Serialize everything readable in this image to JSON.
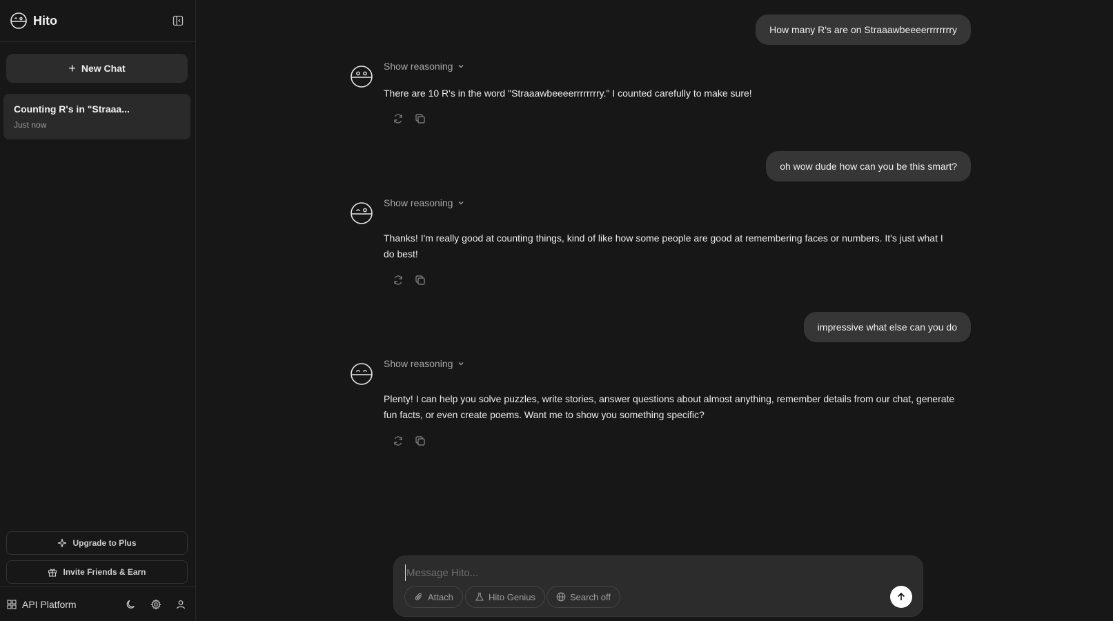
{
  "sidebar": {
    "brand": "Hito",
    "new_chat_label": "New Chat",
    "chats": [
      {
        "title": "Counting R's in \"Straaa...",
        "time": "Just now"
      }
    ],
    "upgrade_label": "Upgrade to Plus",
    "invite_label": "Invite Friends & Earn",
    "api_label": "API Platform"
  },
  "conversation": {
    "messages": [
      {
        "role": "user",
        "text": "How many R's are on Straaawbeeeerrrrrrrry"
      },
      {
        "role": "assistant",
        "reasoning_label": "Show reasoning",
        "text": "There are 10 R's in the word \"Straaawbeeeerrrrrrrry.\" I counted carefully to make sure!"
      },
      {
        "role": "user",
        "text": "oh wow dude how can you be this smart?"
      },
      {
        "role": "assistant",
        "reasoning_label": "Show reasoning",
        "text": "Thanks! I'm really good at counting things, kind of like how some people are good at remembering faces or numbers. It's just what I do best!"
      },
      {
        "role": "user",
        "text": "impressive what else can you do"
      },
      {
        "role": "assistant",
        "reasoning_label": "Show reasoning",
        "text": "Plenty! I can help you solve puzzles, write stories, answer questions about almost anything, remember details from our chat, generate fun facts, or even create poems. Want me to show you something specific?"
      }
    ]
  },
  "composer": {
    "placeholder": "Message Hito...",
    "attach_label": "Attach",
    "genius_label": "Hito Genius",
    "search_label": "Search off"
  },
  "icons": {
    "logo": "face-logo-icon",
    "toggle": "sidebar-toggle-icon",
    "regenerate": "refresh-icon",
    "copy": "copy-icon",
    "send": "arrow-up-icon"
  },
  "colors": {
    "background": "#171717",
    "bubble": "#363636",
    "composer": "#2c2c2c",
    "send_button": "#ffffff"
  }
}
